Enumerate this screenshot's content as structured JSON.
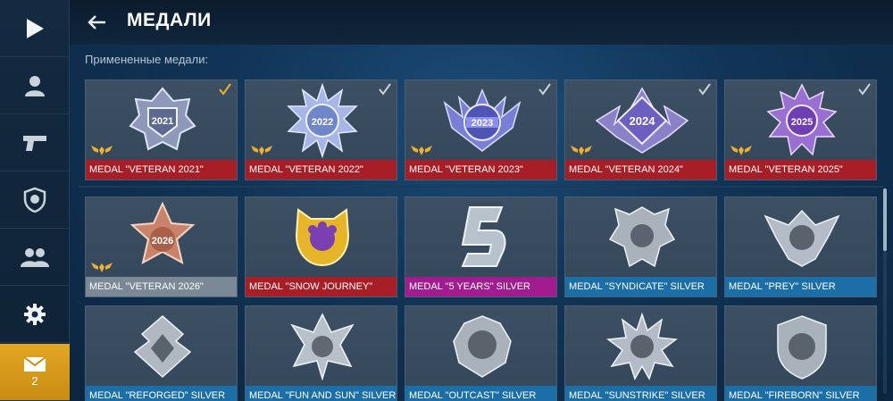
{
  "header": {
    "title": "МЕДАЛИ"
  },
  "section": {
    "applied_label": "Примененные медали:"
  },
  "sidebar": {
    "items": [
      {
        "name": "play",
        "icon": "play-icon"
      },
      {
        "name": "profile",
        "icon": "person-icon"
      },
      {
        "name": "weapons",
        "icon": "pistol-icon"
      },
      {
        "name": "clan",
        "icon": "shield-icon"
      },
      {
        "name": "friends",
        "icon": "people-icon"
      },
      {
        "name": "settings",
        "icon": "gear-icon"
      },
      {
        "name": "mail",
        "icon": "envelope-icon",
        "count": "2"
      }
    ]
  },
  "applied_medals": [
    {
      "label": "MEDAL \"VETERAN 2021\"",
      "year": "2021",
      "color": "#a81e26",
      "checked": true
    },
    {
      "label": "MEDAL \"VETERAN 2022\"",
      "year": "2022",
      "color": "#a81e26",
      "checked": true
    },
    {
      "label": "MEDAL \"VETERAN 2023\"",
      "year": "2023",
      "color": "#a81e26",
      "checked": true
    },
    {
      "label": "MEDAL \"VETERAN 2024\"",
      "year": "2024",
      "color": "#a81e26",
      "checked": true
    },
    {
      "label": "MEDAL \"VETERAN 2025\"",
      "year": "2025",
      "color": "#a81e26",
      "checked": true
    }
  ],
  "medals": [
    {
      "label": "MEDAL \"VETERAN 2026\"",
      "year": "2026",
      "color": "#7b8896"
    },
    {
      "label": "MEDAL \"SNOW JOURNEY\"",
      "color": "#a81e26"
    },
    {
      "label": "MEDAL \"5 YEARS\" SILVER",
      "color": "#a01c8f"
    },
    {
      "label": "MEDAL \"SYNDICATE\" SILVER",
      "color": "#1c6fa6"
    },
    {
      "label": "MEDAL \"PREY\" SILVER",
      "color": "#1c6fa6"
    },
    {
      "label": "MEDAL \"REFORGED\" SILVER",
      "color": "#1c6fa6"
    },
    {
      "label": "MEDAL \"FUN AND SUN\" SILVER",
      "color": "#1c6fa6"
    },
    {
      "label": "MEDAL \"OUTCAST\" SILVER",
      "color": "#1c6fa6"
    },
    {
      "label": "MEDAL \"SUNSTRIKE\" SILVER",
      "color": "#1c6fa6"
    },
    {
      "label": "MEDAL \"FIREBORN\" SILVER",
      "color": "#1c6fa6"
    }
  ],
  "colors": {
    "accent_gold": "#e3a624",
    "rarity_red": "#a81e26",
    "rarity_gray": "#7b8896",
    "rarity_magenta": "#a01c8f",
    "rarity_blue": "#1c6fa6"
  }
}
